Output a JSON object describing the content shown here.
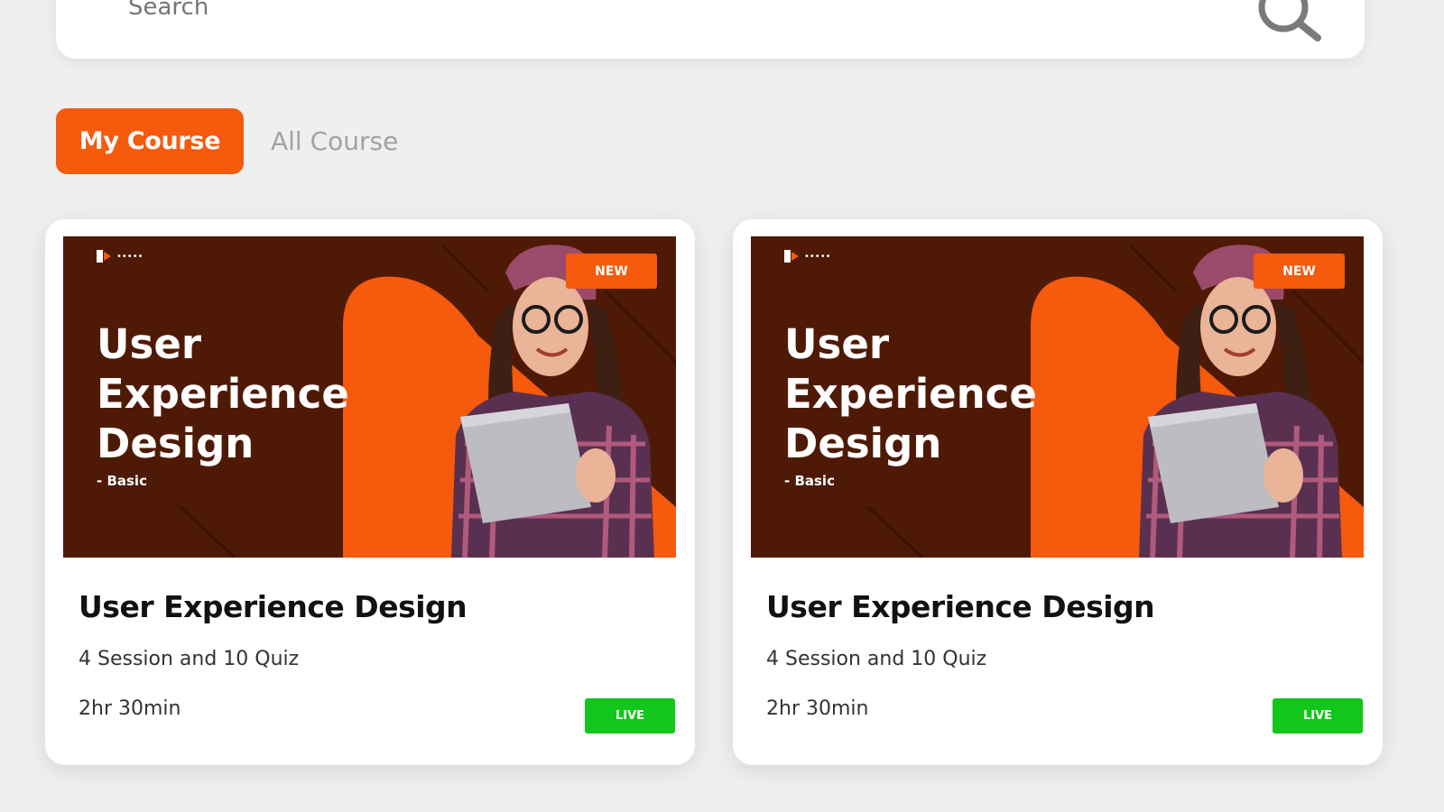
{
  "search": {
    "placeholder": "Search"
  },
  "tabs": [
    {
      "label": "My Course",
      "active": true
    },
    {
      "label": "All Course",
      "active": false
    }
  ],
  "colors": {
    "accent": "#f65a0c",
    "live": "#12c61c",
    "thumb_bg": "#4e1a06"
  },
  "courses": [
    {
      "thumb_title": "User Experience Design",
      "thumb_subtitle": "- Basic",
      "badge": "NEW",
      "title": "User Experience Design",
      "sessions": "4 Session and 10 Quiz",
      "duration": "2hr 30min",
      "status": "LIVE"
    },
    {
      "thumb_title": "User Experience Design",
      "thumb_subtitle": "- Basic",
      "badge": "NEW",
      "title": "User Experience Design",
      "sessions": "4 Session and 10 Quiz",
      "duration": "2hr 30min",
      "status": "LIVE"
    }
  ]
}
